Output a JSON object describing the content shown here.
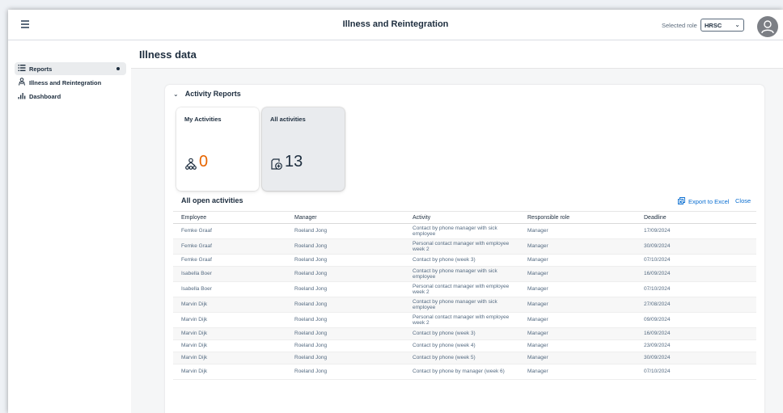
{
  "shell": {
    "title": "Illness and Reintegration",
    "role_label": "Selected role",
    "role_value": "HRSC"
  },
  "sidebar": {
    "items": [
      {
        "label": "Reports",
        "icon": "list-icon",
        "active": true
      },
      {
        "label": "Illness and Reintegration",
        "icon": "person-icon",
        "active": false
      },
      {
        "label": "Dashboard",
        "icon": "bar-chart-icon",
        "active": false
      }
    ]
  },
  "page": {
    "title": "Illness data"
  },
  "panel": {
    "title": "Activity Reports",
    "tiles": [
      {
        "label": "My Activities",
        "value": "0",
        "icon": "org-icon",
        "value_color": "#e76500"
      },
      {
        "label": "All activities",
        "value": "13",
        "icon": "add-activity-icon",
        "value_color": "#1d2d3e"
      }
    ]
  },
  "table": {
    "title": "All open activities",
    "export_label": "Export to Excel",
    "close_label": "Close",
    "columns": [
      "Employee",
      "Manager",
      "Activity",
      "Responsible role",
      "Deadline"
    ],
    "rows": [
      [
        "Femke Graaf",
        "Roeland Jong",
        "Contact by phone manager with sick employee",
        "Manager",
        "17/09/2024"
      ],
      [
        "Femke Graaf",
        "Roeland Jong",
        "Personal contact manager with employee week 2",
        "Manager",
        "30/09/2024"
      ],
      [
        "Femke Graaf",
        "Roeland Jong",
        "Contact by phone (week 3)",
        "Manager",
        "07/10/2024"
      ],
      [
        "Isabella Boer",
        "Roeland Jong",
        "Contact by phone manager with sick employee",
        "Manager",
        "16/09/2024"
      ],
      [
        "Isabella Boer",
        "Roeland Jong",
        "Personal contact manager with employee week 2",
        "Manager",
        "07/10/2024"
      ],
      [
        "Marvin Dijk",
        "Roeland Jong",
        "Contact by phone manager with sick employee",
        "Manager",
        "27/08/2024"
      ],
      [
        "Marvin Dijk",
        "Roeland Jong",
        "Personal contact manager with employee week 2",
        "Manager",
        "09/09/2024"
      ],
      [
        "Marvin Dijk",
        "Roeland Jong",
        "Contact by phone (week 3)",
        "Manager",
        "16/09/2024"
      ],
      [
        "Marvin Dijk",
        "Roeland Jong",
        "Contact by phone (week 4)",
        "Manager",
        "23/09/2024"
      ],
      [
        "Marvin Dijk",
        "Roeland Jong",
        "Contact by phone (week 5)",
        "Manager",
        "30/09/2024"
      ],
      [
        "Marvin Dijk",
        "Roeland Jong",
        "Contact by phone by manager (week 6)",
        "Manager",
        "07/10/2024"
      ]
    ]
  }
}
